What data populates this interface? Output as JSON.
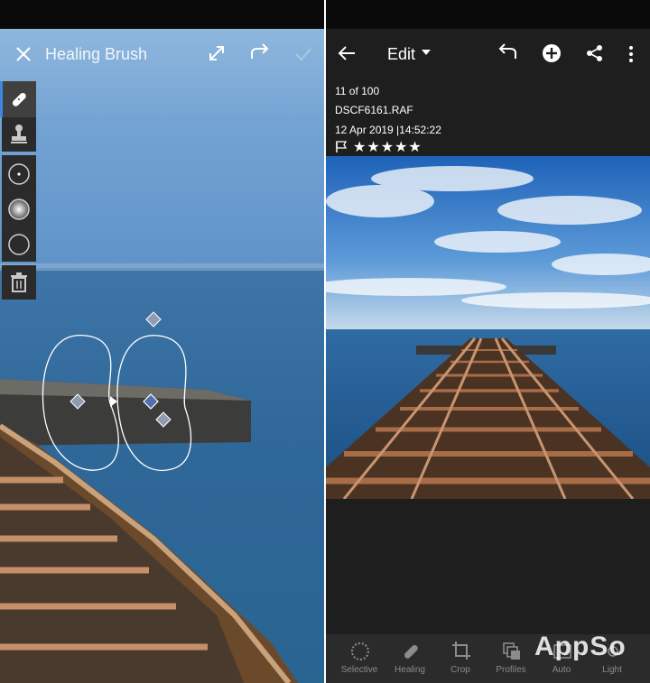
{
  "healing_screen": {
    "title": "Healing Brush"
  },
  "edit_screen": {
    "title": "Edit",
    "counter": "11 of 100",
    "filename": "DSCF6161.RAF",
    "datetime": "12 Apr 2019 |14:52:22",
    "rating": "★★★★★",
    "tabs": [
      {
        "label": "Selective",
        "icon": "selective-icon"
      },
      {
        "label": "Healing",
        "icon": "bandage-icon"
      },
      {
        "label": "Crop",
        "icon": "crop-icon"
      },
      {
        "label": "Profiles",
        "icon": "profiles-icon"
      },
      {
        "label": "Auto",
        "icon": "auto-icon"
      },
      {
        "label": "Light",
        "icon": "light-icon"
      }
    ]
  },
  "watermark": "AppSo"
}
